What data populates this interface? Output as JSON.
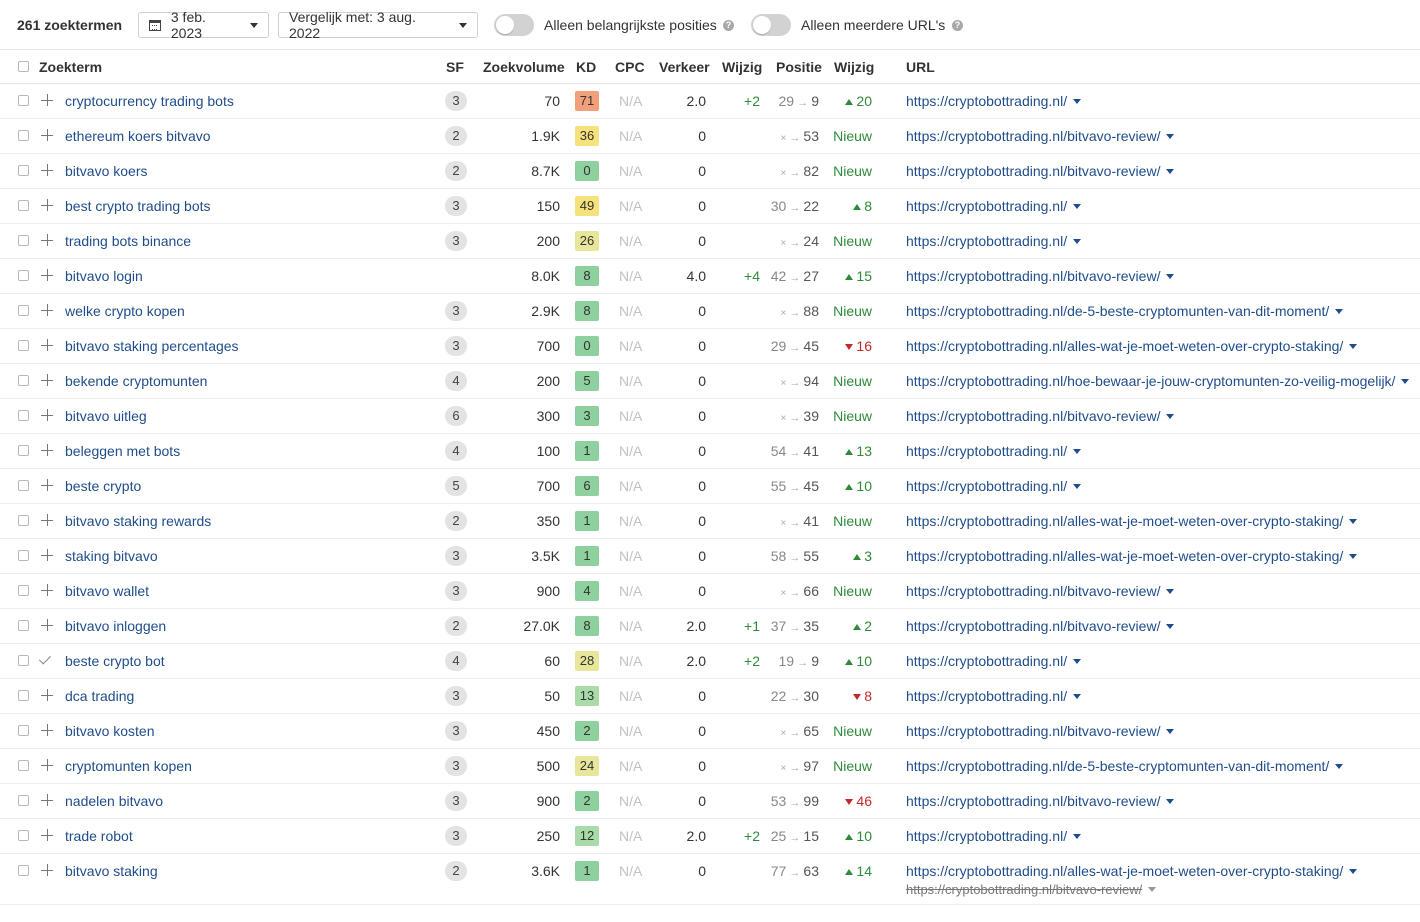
{
  "toolbar": {
    "count": "261 zoektermen",
    "date": "3 feb. 2023",
    "compare": "Vergelijk met: 3 aug. 2022",
    "toggle1": "Alleen belangrijkste posities",
    "toggle2": "Alleen meerdere URL's",
    "help": "?"
  },
  "columns": [
    "Zoekterm",
    "SF",
    "Zoekvolume",
    "KD",
    "CPC",
    "Verkeer",
    "Wijzig",
    "Positie",
    "Wijzig",
    "URL"
  ],
  "colors": {
    "link": "#1f4d8c",
    "up": "#2f8a3a",
    "down": "#c62828",
    "kd_red": "#f2a07b",
    "kd_yellow": "#f5e27a",
    "kd_lightyellow": "#e8e69a",
    "kd_green": "#8fd19e"
  },
  "rows": [
    {
      "kw": "cryptocurrency trading bots",
      "sf": "3",
      "vol": "70",
      "kd": "71",
      "kdc": "#f2a07b",
      "cpc": "N/A",
      "traffic": "2.0",
      "tchange": "+2",
      "from": "29",
      "to": "9",
      "pdir": "up",
      "pchange": "20",
      "url": "https://cryptobottrading.nl/",
      "icon": "plus"
    },
    {
      "kw": "ethereum koers bitvavo",
      "sf": "2",
      "vol": "1.9K",
      "kd": "36",
      "kdc": "#f5e27a",
      "cpc": "N/A",
      "traffic": "0",
      "tchange": "",
      "from": "",
      "to": "53",
      "pdir": "new",
      "pchange": "Nieuw",
      "url": "https://cryptobottrading.nl/bitvavo-review/",
      "icon": "plus"
    },
    {
      "kw": "bitvavo koers",
      "sf": "2",
      "vol": "8.7K",
      "kd": "0",
      "kdc": "#8fd19e",
      "cpc": "N/A",
      "traffic": "0",
      "tchange": "",
      "from": "",
      "to": "82",
      "pdir": "new",
      "pchange": "Nieuw",
      "url": "https://cryptobottrading.nl/bitvavo-review/",
      "icon": "plus"
    },
    {
      "kw": "best crypto trading bots",
      "sf": "3",
      "vol": "150",
      "kd": "49",
      "kdc": "#f5e27a",
      "cpc": "N/A",
      "traffic": "0",
      "tchange": "",
      "from": "30",
      "to": "22",
      "pdir": "up",
      "pchange": "8",
      "url": "https://cryptobottrading.nl/",
      "icon": "plus"
    },
    {
      "kw": "trading bots binance",
      "sf": "3",
      "vol": "200",
      "kd": "26",
      "kdc": "#e8e69a",
      "cpc": "N/A",
      "traffic": "0",
      "tchange": "",
      "from": "",
      "to": "24",
      "pdir": "new",
      "pchange": "Nieuw",
      "url": "https://cryptobottrading.nl/",
      "icon": "plus"
    },
    {
      "kw": "bitvavo login",
      "sf": "",
      "vol": "8.0K",
      "kd": "8",
      "kdc": "#8fd19e",
      "cpc": "N/A",
      "traffic": "4.0",
      "tchange": "+4",
      "from": "42",
      "to": "27",
      "pdir": "up",
      "pchange": "15",
      "url": "https://cryptobottrading.nl/bitvavo-review/",
      "icon": "plus"
    },
    {
      "kw": "welke crypto kopen",
      "sf": "3",
      "vol": "2.9K",
      "kd": "8",
      "kdc": "#8fd19e",
      "cpc": "N/A",
      "traffic": "0",
      "tchange": "",
      "from": "",
      "to": "88",
      "pdir": "new",
      "pchange": "Nieuw",
      "url": "https://cryptobottrading.nl/de-5-beste-cryptomunten-van-dit-moment/",
      "icon": "plus"
    },
    {
      "kw": "bitvavo staking percentages",
      "sf": "3",
      "vol": "700",
      "kd": "0",
      "kdc": "#8fd19e",
      "cpc": "N/A",
      "traffic": "0",
      "tchange": "",
      "from": "29",
      "to": "45",
      "pdir": "down",
      "pchange": "16",
      "url": "https://cryptobottrading.nl/alles-wat-je-moet-weten-over-crypto-staking/",
      "icon": "plus"
    },
    {
      "kw": "bekende cryptomunten",
      "sf": "4",
      "vol": "200",
      "kd": "5",
      "kdc": "#8fd19e",
      "cpc": "N/A",
      "traffic": "0",
      "tchange": "",
      "from": "",
      "to": "94",
      "pdir": "new",
      "pchange": "Nieuw",
      "url": "https://cryptobottrading.nl/hoe-bewaar-je-jouw-cryptomunten-zo-veilig-mogelijk/",
      "icon": "plus"
    },
    {
      "kw": "bitvavo uitleg",
      "sf": "6",
      "vol": "300",
      "kd": "3",
      "kdc": "#8fd19e",
      "cpc": "N/A",
      "traffic": "0",
      "tchange": "",
      "from": "",
      "to": "39",
      "pdir": "new",
      "pchange": "Nieuw",
      "url": "https://cryptobottrading.nl/bitvavo-review/",
      "icon": "plus"
    },
    {
      "kw": "beleggen met bots",
      "sf": "4",
      "vol": "100",
      "kd": "1",
      "kdc": "#8fd19e",
      "cpc": "N/A",
      "traffic": "0",
      "tchange": "",
      "from": "54",
      "to": "41",
      "pdir": "up",
      "pchange": "13",
      "url": "https://cryptobottrading.nl/",
      "icon": "plus"
    },
    {
      "kw": "beste crypto",
      "sf": "5",
      "vol": "700",
      "kd": "6",
      "kdc": "#8fd19e",
      "cpc": "N/A",
      "traffic": "0",
      "tchange": "",
      "from": "55",
      "to": "45",
      "pdir": "up",
      "pchange": "10",
      "url": "https://cryptobottrading.nl/",
      "icon": "plus"
    },
    {
      "kw": "bitvavo staking rewards",
      "sf": "2",
      "vol": "350",
      "kd": "1",
      "kdc": "#8fd19e",
      "cpc": "N/A",
      "traffic": "0",
      "tchange": "",
      "from": "",
      "to": "41",
      "pdir": "new",
      "pchange": "Nieuw",
      "url": "https://cryptobottrading.nl/alles-wat-je-moet-weten-over-crypto-staking/",
      "icon": "plus"
    },
    {
      "kw": "staking bitvavo",
      "sf": "3",
      "vol": "3.5K",
      "kd": "1",
      "kdc": "#8fd19e",
      "cpc": "N/A",
      "traffic": "0",
      "tchange": "",
      "from": "58",
      "to": "55",
      "pdir": "up",
      "pchange": "3",
      "url": "https://cryptobottrading.nl/alles-wat-je-moet-weten-over-crypto-staking/",
      "icon": "plus"
    },
    {
      "kw": "bitvavo wallet",
      "sf": "3",
      "vol": "900",
      "kd": "4",
      "kdc": "#8fd19e",
      "cpc": "N/A",
      "traffic": "0",
      "tchange": "",
      "from": "",
      "to": "66",
      "pdir": "new",
      "pchange": "Nieuw",
      "url": "https://cryptobottrading.nl/bitvavo-review/",
      "icon": "plus"
    },
    {
      "kw": "bitvavo inloggen",
      "sf": "2",
      "vol": "27.0K",
      "kd": "8",
      "kdc": "#8fd19e",
      "cpc": "N/A",
      "traffic": "2.0",
      "tchange": "+1",
      "from": "37",
      "to": "35",
      "pdir": "up",
      "pchange": "2",
      "url": "https://cryptobottrading.nl/bitvavo-review/",
      "icon": "plus"
    },
    {
      "kw": "beste crypto bot",
      "sf": "4",
      "vol": "60",
      "kd": "28",
      "kdc": "#e8e69a",
      "cpc": "N/A",
      "traffic": "2.0",
      "tchange": "+2",
      "from": "19",
      "to": "9",
      "pdir": "up",
      "pchange": "10",
      "url": "https://cryptobottrading.nl/",
      "icon": "check"
    },
    {
      "kw": "dca trading",
      "sf": "3",
      "vol": "50",
      "kd": "13",
      "kdc": "#a9dba8",
      "cpc": "N/A",
      "traffic": "0",
      "tchange": "",
      "from": "22",
      "to": "30",
      "pdir": "down",
      "pchange": "8",
      "url": "https://cryptobottrading.nl/",
      "icon": "plus"
    },
    {
      "kw": "bitvavo kosten",
      "sf": "3",
      "vol": "450",
      "kd": "2",
      "kdc": "#8fd19e",
      "cpc": "N/A",
      "traffic": "0",
      "tchange": "",
      "from": "",
      "to": "65",
      "pdir": "new",
      "pchange": "Nieuw",
      "url": "https://cryptobottrading.nl/bitvavo-review/",
      "icon": "plus"
    },
    {
      "kw": "cryptomunten kopen",
      "sf": "3",
      "vol": "500",
      "kd": "24",
      "kdc": "#e8e69a",
      "cpc": "N/A",
      "traffic": "0",
      "tchange": "",
      "from": "",
      "to": "97",
      "pdir": "new",
      "pchange": "Nieuw",
      "url": "https://cryptobottrading.nl/de-5-beste-cryptomunten-van-dit-moment/",
      "icon": "plus"
    },
    {
      "kw": "nadelen bitvavo",
      "sf": "3",
      "vol": "900",
      "kd": "2",
      "kdc": "#8fd19e",
      "cpc": "N/A",
      "traffic": "0",
      "tchange": "",
      "from": "53",
      "to": "99",
      "pdir": "down",
      "pchange": "46",
      "url": "https://cryptobottrading.nl/bitvavo-review/",
      "icon": "plus"
    },
    {
      "kw": "trade robot",
      "sf": "3",
      "vol": "250",
      "kd": "12",
      "kdc": "#a9dba8",
      "cpc": "N/A",
      "traffic": "2.0",
      "tchange": "+2",
      "from": "25",
      "to": "15",
      "pdir": "up",
      "pchange": "10",
      "url": "https://cryptobottrading.nl/",
      "icon": "plus"
    },
    {
      "kw": "bitvavo staking",
      "sf": "2",
      "vol": "3.6K",
      "kd": "1",
      "kdc": "#8fd19e",
      "cpc": "N/A",
      "traffic": "0",
      "tchange": "",
      "from": "77",
      "to": "63",
      "pdir": "up",
      "pchange": "14",
      "url": "https://cryptobottrading.nl/alles-wat-je-moet-weten-over-crypto-staking/",
      "url2": "https://cryptobottrading.nl/bitvavo-review/",
      "icon": "plus"
    }
  ]
}
